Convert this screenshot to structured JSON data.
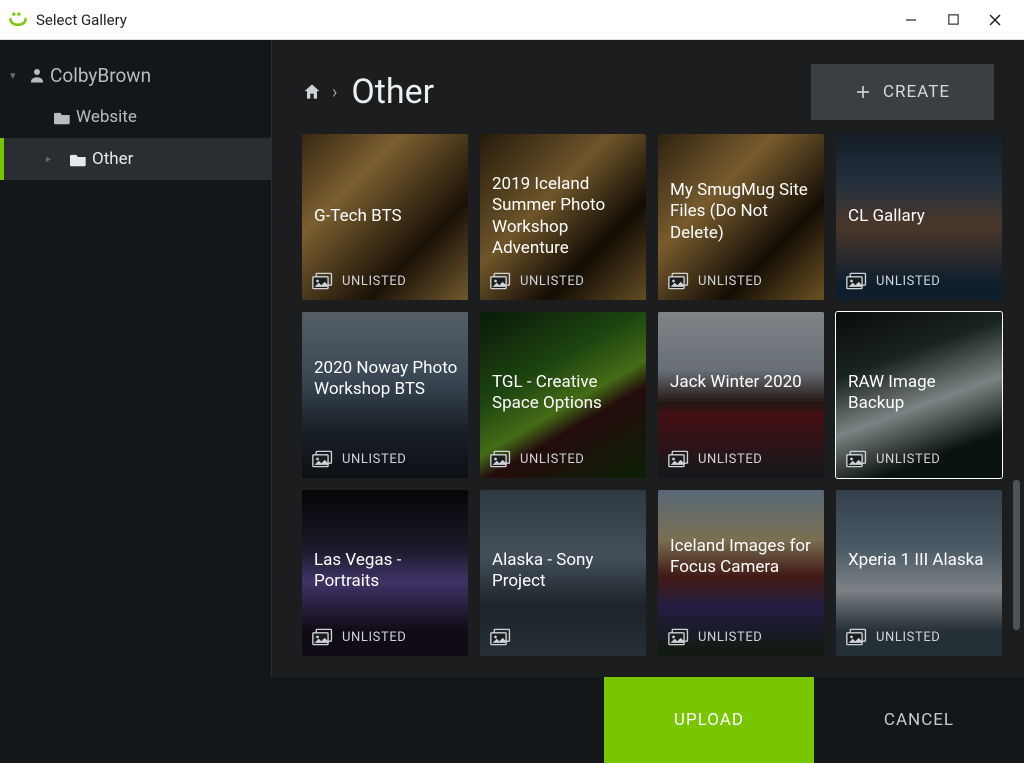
{
  "window": {
    "title": "Select Gallery"
  },
  "tree": {
    "user": "ColbyBrown",
    "items": [
      {
        "label": "Website",
        "selected": false
      },
      {
        "label": "Other",
        "selected": true
      }
    ]
  },
  "header": {
    "title": "Other",
    "create_label": "CREATE"
  },
  "status_text": "UNLISTED",
  "galleries": [
    {
      "title": "G-Tech BTS",
      "status": "UNLISTED",
      "bg_css": "linear-gradient(135deg,#5a3f1e,#c79a4e 30%,#2a1c0c 70%,#b8914a)",
      "selected": false,
      "lines": 1
    },
    {
      "title": "2019 Iceland Summer Photo Workshop Adventure",
      "status": "UNLISTED",
      "bg_css": "linear-gradient(135deg,#3d2c14,#b38a44 40%,#1e1408 70%,#a17c3a)",
      "selected": false,
      "lines": 4
    },
    {
      "title": "My SmugMug Site Files (Do Not Delete)",
      "status": "UNLISTED",
      "bg_css": "linear-gradient(135deg,#4b381c,#c2944a 35%,#211609 70%,#b08539)",
      "selected": false,
      "lines": 3
    },
    {
      "title": "CL Gallary",
      "status": "UNLISTED",
      "bg_css": "linear-gradient(180deg,#223041,#3a4e63 30%,#7a5a45 55%,#18314a 90%)",
      "selected": false,
      "lines": 1
    },
    {
      "title": "2020 Noway Photo Workshop BTS",
      "status": "UNLISTED",
      "bg_css": "linear-gradient(180deg,#8a99a5,#5e7486 40%,#2a3642 70%,#141a21)",
      "selected": false,
      "lines": 3
    },
    {
      "title": "TGL - Creative Space Options",
      "status": "UNLISTED",
      "bg_css": "linear-gradient(150deg,#0e2a0d,#2f6e1a 35%,#6fae24 55%,#3a1414 65%,#123409)",
      "selected": false,
      "lines": 2
    },
    {
      "title": "Jack Winter 2020",
      "status": "UNLISTED",
      "bg_css": "linear-gradient(180deg,#cdd5db,#a8b4bd 35%,#3a2420 55%,#6f1a20 62%,#20272d)",
      "selected": false,
      "lines": 2
    },
    {
      "title": "RAW Image Backup",
      "status": "UNLISTED",
      "bg_css": "linear-gradient(160deg,#0d1416,#2a3a34 30%,#c6d3d4 55%,#122019 80%)",
      "selected": true,
      "lines": 2
    },
    {
      "title": "Las Vegas - Portraits",
      "status": "UNLISTED",
      "bg_css": "linear-gradient(180deg,#0a0a0d,#2e2740 35%,#6754a8 55%,#1a1222 85%)",
      "selected": false,
      "lines": 2
    },
    {
      "title": "Alaska - Sony Project",
      "status": "",
      "bg_css": "linear-gradient(180deg,#4c5c68,#6d8091 40%,#2f3a43 70%,#3e4d58)",
      "selected": false,
      "lines": 2
    },
    {
      "title": "Iceland Images for Focus Camera",
      "status": "UNLISTED",
      "bg_css": "linear-gradient(180deg,#8fa9c2,#c3b383 30%,#6b2a22 52%,#3a2f6a 70%,#1a2b16)",
      "selected": false,
      "lines": 3
    },
    {
      "title": "Xperia 1 III Alaska",
      "status": "UNLISTED",
      "bg_css": "linear-gradient(180deg,#54687a,#7991a3 35%,#c8d2d8 60%,#3d4d58 85%)",
      "selected": false,
      "lines": 2
    }
  ],
  "footer": {
    "upload_label": "UPLOAD",
    "cancel_label": "CANCEL"
  },
  "colors": {
    "accent": "#77c600",
    "panel": "#1b1d1f",
    "sidebar": "#14171a"
  }
}
